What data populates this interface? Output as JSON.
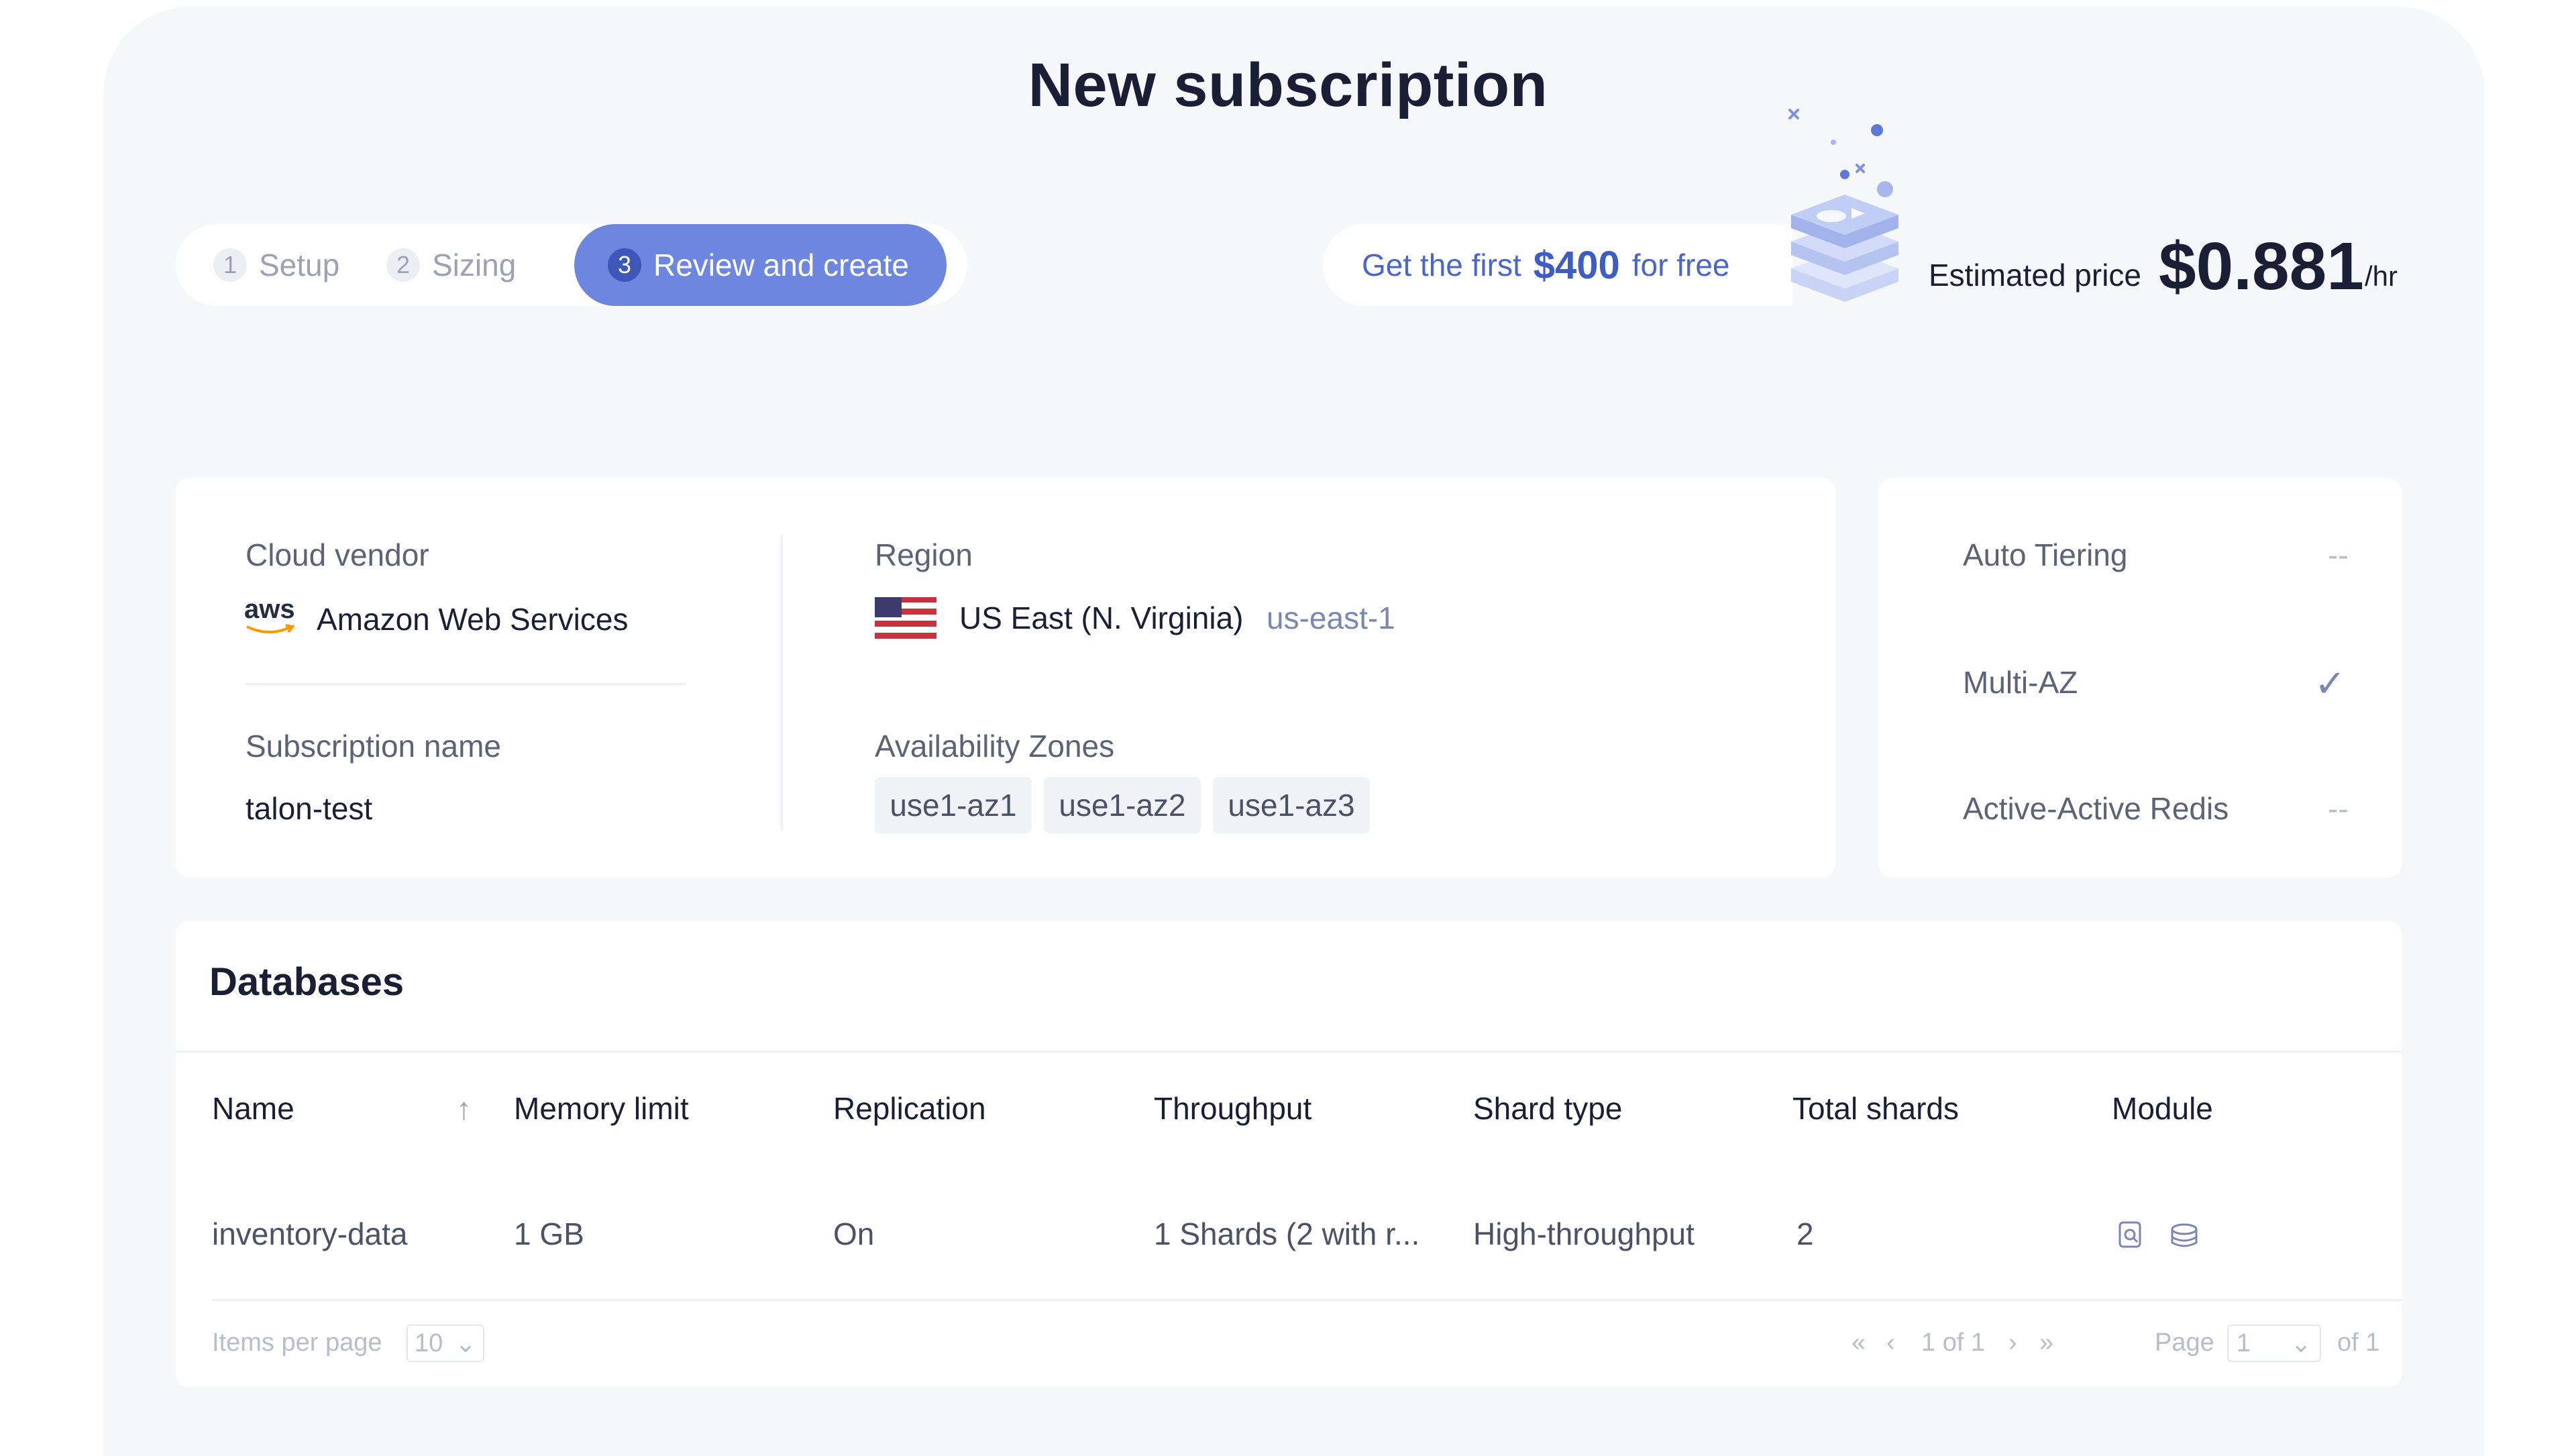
{
  "page": {
    "title": "New subscription"
  },
  "stepper": {
    "steps": [
      {
        "num": "1",
        "label": "Setup"
      },
      {
        "num": "2",
        "label": "Sizing"
      },
      {
        "num": "3",
        "label": "Review and create"
      }
    ]
  },
  "promo": {
    "prefix": "Get the first",
    "amount": "$400",
    "suffix": "for free"
  },
  "price": {
    "label": "Estimated price",
    "value": "$0.881",
    "unit": "/hr"
  },
  "details": {
    "cloud_vendor_label": "Cloud vendor",
    "cloud_vendor_logo": "aws",
    "cloud_vendor_value": "Amazon Web Services",
    "subscription_name_label": "Subscription name",
    "subscription_name_value": "talon-test",
    "region_label": "Region",
    "region_value": "US East (N. Virginia)",
    "region_code": "us-east-1",
    "az_label": "Availability Zones",
    "zones": [
      "use1-az1",
      "use1-az2",
      "use1-az3"
    ]
  },
  "features": {
    "auto_tiering_label": "Auto Tiering",
    "auto_tiering_value": "--",
    "multi_az_label": "Multi-AZ",
    "multi_az_value": "✓",
    "active_active_label": "Active-Active Redis",
    "active_active_value": "--"
  },
  "databases": {
    "title": "Databases",
    "columns": [
      "Name",
      "Memory limit",
      "Replication",
      "Throughput",
      "Shard type",
      "Total shards",
      "Module"
    ],
    "sort_icon": "↑",
    "rows": [
      {
        "name": "inventory-data",
        "memory": "1 GB",
        "replication": "On",
        "throughput": "1 Shards (2 with r...",
        "shard_type": "High-throughput",
        "total_shards": "2"
      }
    ],
    "footer": {
      "items_per_page_label": "Items per page",
      "items_per_page_value": "10",
      "range_text": "1 of 1",
      "page_label": "Page",
      "page_value": "1",
      "of_pages": "of 1"
    }
  },
  "colors": {
    "accent": "#6d86e0",
    "accent_dark": "#3d56b8",
    "link": "#4a66c9"
  }
}
